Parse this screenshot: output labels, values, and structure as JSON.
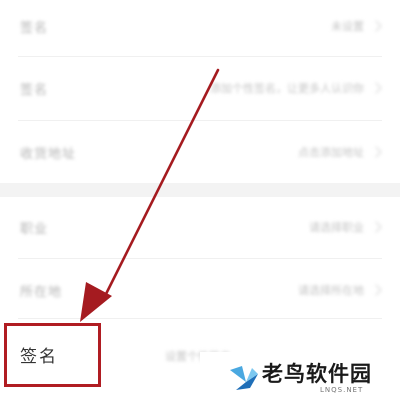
{
  "rows": [
    {
      "label": "签名",
      "value": "未设置"
    },
    {
      "label": "签名",
      "value": "添加个性签名，让更多人认识你"
    },
    {
      "label": "收货地址",
      "value": "点击添加地址"
    },
    {
      "label": "职业",
      "value": "请选择职业"
    },
    {
      "label": "所在地",
      "value": "请选择所在地"
    }
  ],
  "signature": {
    "label": "签名",
    "value": "设置个性签名"
  },
  "watermark": {
    "brand": "老鸟软件园",
    "sub": "LNQS.NET"
  },
  "colors": {
    "highlight": "#b01c22",
    "arrow": "#a51b20",
    "background": "#ffffff",
    "section_gap": "#f3f3f3"
  }
}
